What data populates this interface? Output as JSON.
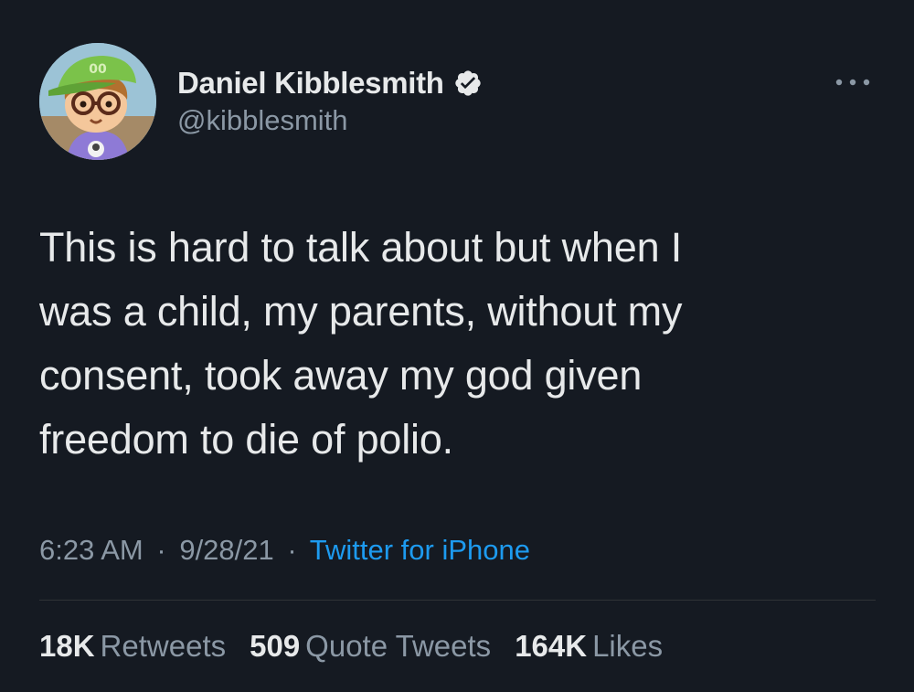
{
  "author": {
    "display_name": "Daniel Kibblesmith",
    "handle": "@kibblesmith",
    "verified": true,
    "avatar_icon": "animal-crossing-villager-avatar"
  },
  "tweet": {
    "text_lines": [
      "This is hard to talk about but when I",
      "was a child, my parents, without my",
      "consent, took away my god given",
      "freedom to die of polio."
    ]
  },
  "meta": {
    "time": "6:23 AM",
    "separator": "·",
    "date": "9/28/21",
    "source": "Twitter for iPhone"
  },
  "stats": {
    "retweets_count": "18K",
    "retweets_label": "Retweets",
    "quotes_count": "509",
    "quotes_label": "Quote Tweets",
    "likes_count": "164K",
    "likes_label": "Likes"
  },
  "colors": {
    "background": "#151a22",
    "text_primary": "#e7e9ea",
    "text_secondary": "#8b98a5",
    "link": "#1d9bf0",
    "divider": "#2f3336"
  },
  "icons": {
    "verified": "verified-badge-icon",
    "more": "more-options-icon"
  }
}
